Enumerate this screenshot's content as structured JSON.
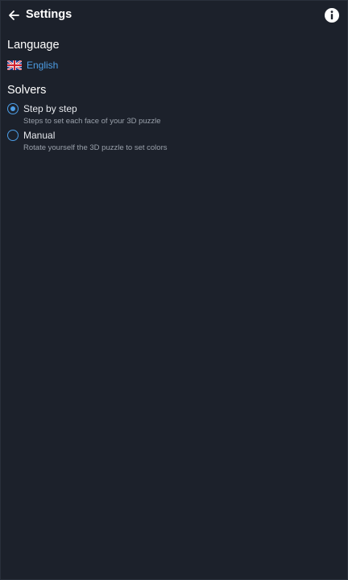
{
  "appbar": {
    "title": "Settings",
    "back_icon": "arrow-left-icon",
    "info_icon": "info-icon"
  },
  "language": {
    "heading": "Language",
    "flag_icon": "uk-flag-icon",
    "selected": "English"
  },
  "solvers": {
    "heading": "Solvers",
    "options": [
      {
        "label": "Step by step",
        "description": "Steps to set each face of your 3D puzzle",
        "selected": true
      },
      {
        "label": "Manual",
        "description": "Rotate yourself the 3D puzzle to set colors",
        "selected": false
      }
    ]
  },
  "colors": {
    "background": "#1c212b",
    "accent": "#4d9ee6",
    "text": "#ffffff",
    "muted_text": "#9aa1ab"
  }
}
